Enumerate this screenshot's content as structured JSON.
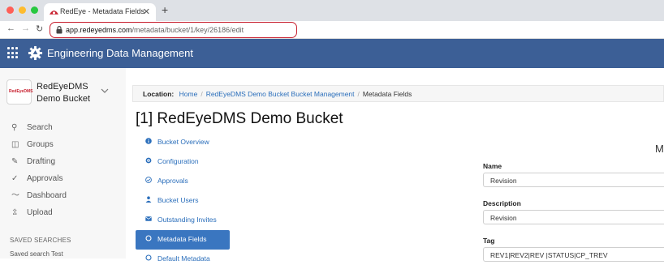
{
  "browser": {
    "tab_title": "RedEye - Metadata Fields",
    "tab_close": "✕",
    "new_tab": "+",
    "url_host": "app.redeyedms.com",
    "url_path": "/metadata/bucket/1/key/26186/edit",
    "back": "←",
    "forward": "→",
    "reload": "↻"
  },
  "header": {
    "title": "Engineering Data Management"
  },
  "sidebar": {
    "logo_text": "RedEyeDMS",
    "bucket_name": "RedEyeDMS Demo Bucket",
    "items": [
      {
        "label": "Search",
        "icon": "search-icon",
        "glyph": "⚲"
      },
      {
        "label": "Groups",
        "icon": "groups-icon",
        "glyph": "◫"
      },
      {
        "label": "Drafting",
        "icon": "pencil-icon",
        "glyph": "✎"
      },
      {
        "label": "Approvals",
        "icon": "check-icon",
        "glyph": "✓"
      },
      {
        "label": "Dashboard",
        "icon": "chart-icon",
        "glyph": "〜"
      },
      {
        "label": "Upload",
        "icon": "upload-icon",
        "glyph": "⇫"
      }
    ],
    "saved_searches_header": "SAVED SEARCHES",
    "saved_search_item": "Saved search Test"
  },
  "breadcrumb": {
    "label": "Location:",
    "home": "Home",
    "bucket_mgmt": "RedEyeDMS Demo Bucket Bucket Management",
    "current": "Metadata Fields"
  },
  "page": {
    "title": "[1] RedEyeDMS Demo Bucket",
    "right_partial_heading": "M"
  },
  "menu": {
    "items": [
      {
        "label": "Bucket Overview",
        "icon": "info-icon",
        "active": false
      },
      {
        "label": "Configuration",
        "icon": "cog-icon",
        "active": false
      },
      {
        "label": "Approvals",
        "icon": "check-circle-icon",
        "active": false
      },
      {
        "label": "Bucket Users",
        "icon": "user-icon",
        "active": false
      },
      {
        "label": "Outstanding Invites",
        "icon": "envelope-icon",
        "active": false
      },
      {
        "label": "Metadata Fields",
        "icon": "circle-icon",
        "active": true
      },
      {
        "label": "Default Metadata",
        "icon": "circle-icon",
        "active": false
      }
    ]
  },
  "form": {
    "name_label": "Name",
    "name_value": "Revision",
    "description_label": "Description",
    "description_value": "Revision",
    "tag_label": "Tag",
    "tag_value": "REV1|REV2|REV |STATUS|CP_TREV"
  },
  "colors": {
    "header_bg": "#3c5f96",
    "link": "#2a6ebb",
    "active_menu": "#3a76c0",
    "url_highlight": "#c8202f"
  }
}
